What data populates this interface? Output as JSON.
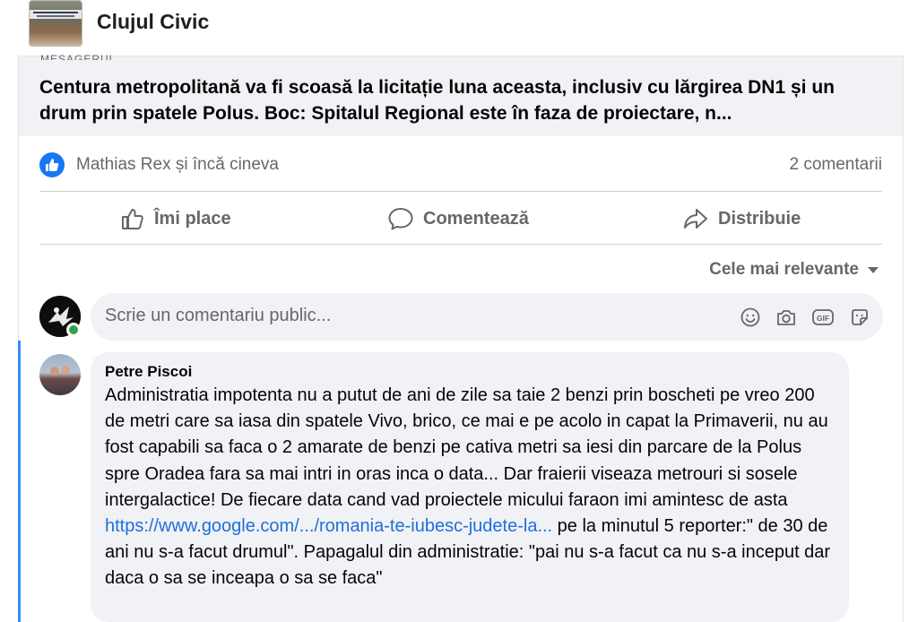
{
  "header": {
    "page_name": "Clujul Civic"
  },
  "link_card": {
    "domain": "MESAGERUL",
    "title": "Centura metropolitană va fi scoasă la licitație luna aceasta, inclusiv cu lărgirea DN1 și un drum prin spatele Polus. Boc: Spitalul Regional este în faza de proiectare, n..."
  },
  "reactions": {
    "names": "Mathias Rex și încă cineva",
    "comment_count": "2 comentarii"
  },
  "actions": {
    "like_label": "Îmi place",
    "comment_label": "Comentează",
    "share_label": "Distribuie"
  },
  "sort": {
    "label": "Cele mai relevante"
  },
  "composer": {
    "placeholder": "Scrie un comentariu public..."
  },
  "comment": {
    "author": "Petre Piscoi",
    "text_before": "Administratia impotenta nu a putut de ani de zile sa taie 2 benzi prin boscheti pe vreo 200 de metri care sa iasa din spatele Vivo, brico, ce mai e pe acolo in capat la Primaverii, nu au fost capabili sa faca o 2 amarate de benzi pe cativa metri sa iesi din parcare de la Polus spre Oradea fara sa mai intri in oras inca o data... Dar fraierii viseaza metrouri si sosele intergalactice! De fiecare data cand vad proiectele micului faraon imi amintesc de asta ",
    "link_text": "https://www.google.com/.../romania-te-iubesc-judete-la...",
    "text_after": " pe la minutul 5 reporter:\" de 30 de ani nu s-a facut drumul\". Papagalul din administratie: \"pai nu s-a facut ca nu s-a inceput dar daca o sa se inceapa o sa se faca\""
  },
  "colors": {
    "accent": "#1877f2",
    "link": "#216fdb",
    "bubble": "#f0f2f5",
    "muted_text": "#65676b",
    "online": "#31a24c"
  },
  "icons": [
    "like-badge-icon",
    "thumbs-up-icon",
    "comment-icon",
    "share-icon",
    "caret-down-icon",
    "emoji-icon",
    "camera-icon",
    "gif-icon",
    "sticker-icon"
  ]
}
